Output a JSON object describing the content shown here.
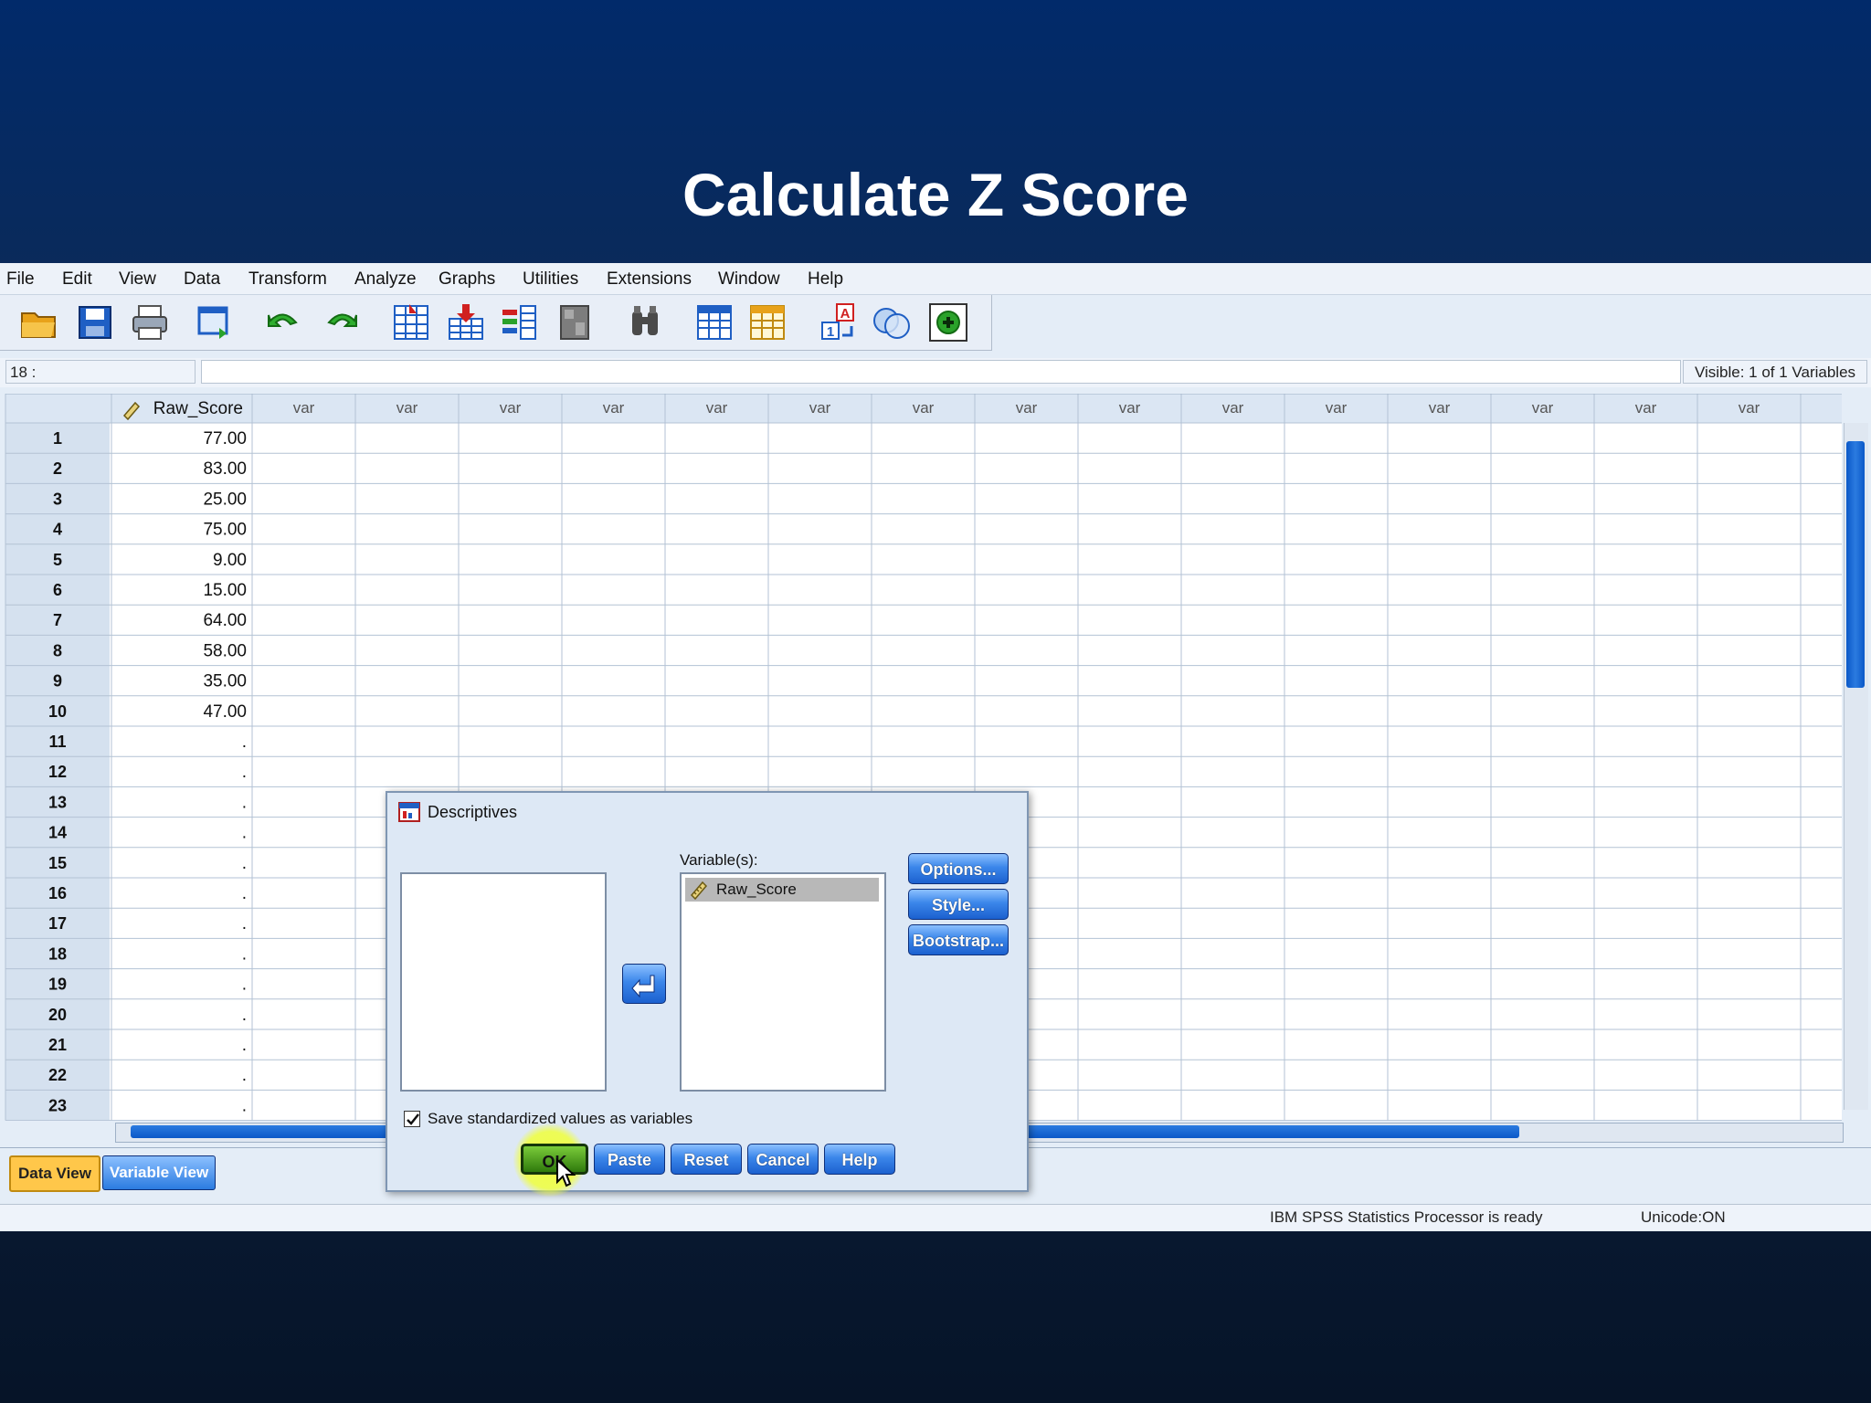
{
  "slide": {
    "title": "Calculate Z Score"
  },
  "menu": [
    "File",
    "Edit",
    "View",
    "Data",
    "Transform",
    "Analyze",
    "Graphs",
    "Utilities",
    "Extensions",
    "Window",
    "Help"
  ],
  "toolbar_icons": [
    "open-icon",
    "save-icon",
    "print-icon",
    "recall-dialog-icon",
    "undo-icon",
    "redo-icon",
    "goto-case-icon",
    "goto-variable-icon",
    "variables-icon",
    "run-descriptives-icon",
    "find-icon",
    "insert-cases-icon",
    "insert-variable-icon",
    "value-labels-icon",
    "use-sets-icon",
    "spell-check-icon"
  ],
  "cell_editor": {
    "ref": "18 :",
    "value": "",
    "visible": "Visible: 1 of 1 Variables"
  },
  "grid": {
    "first_column": "Raw_Score",
    "empty_column_label": "var",
    "rows": [
      "1",
      "2",
      "3",
      "4",
      "5",
      "6",
      "7",
      "8",
      "9",
      "10",
      "11",
      "12",
      "13",
      "14",
      "15",
      "16",
      "17",
      "18",
      "19",
      "20",
      "21",
      "22",
      "23"
    ],
    "raw_scores": [
      "77.00",
      "83.00",
      "25.00",
      "75.00",
      "9.00",
      "15.00",
      "64.00",
      "58.00",
      "35.00",
      "47.00",
      ".",
      ".",
      ".",
      ".",
      ".",
      ".",
      ".",
      ".",
      ".",
      ".",
      ".",
      ".",
      "."
    ],
    "selected_cell_row": "18"
  },
  "tabs": {
    "data_view": "Data View",
    "variable_view": "Variable View"
  },
  "status": {
    "processor": "IBM SPSS Statistics Processor is ready",
    "unicode": "Unicode:ON"
  },
  "dialog": {
    "title": "Descriptives",
    "variables_label": "Variable(s):",
    "selected_variable": "Raw_Score",
    "checkbox_label": "Save standardized values as variables",
    "checkbox_checked": true,
    "buttons": {
      "options": "Options...",
      "style": "Style...",
      "bootstrap": "Bootstrap...",
      "ok": "OK",
      "paste": "Paste",
      "reset": "Reset",
      "cancel": "Cancel",
      "help": "Help"
    }
  },
  "colors": {
    "accent_blue": "#1c61cf",
    "ok_green": "#3f8a14",
    "selected_cell": "#ffd36b",
    "active_tab": "#ffc74a",
    "highlight": "#f0ff3c"
  }
}
